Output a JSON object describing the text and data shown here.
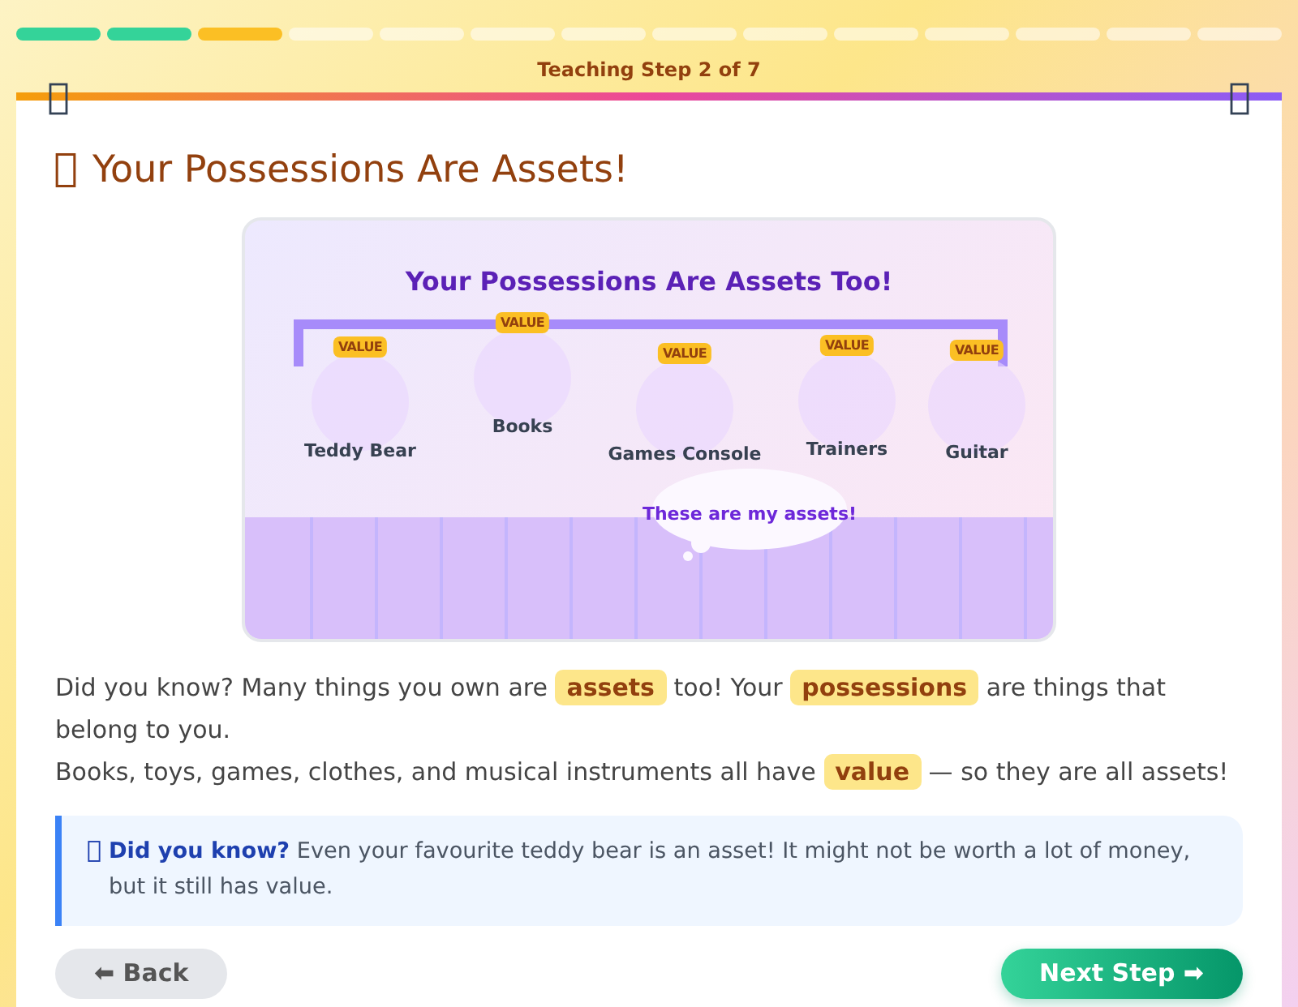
{
  "progress": {
    "segments": [
      {
        "kind": "done"
      },
      {
        "kind": "done"
      },
      {
        "kind": "current"
      },
      {
        "kind": "todo"
      },
      {
        "kind": "todo"
      },
      {
        "kind": "todo"
      },
      {
        "kind": "todo"
      },
      {
        "kind": "todo"
      },
      {
        "kind": "todo"
      },
      {
        "kind": "todo"
      },
      {
        "kind": "todo"
      },
      {
        "kind": "todo"
      },
      {
        "kind": "todo"
      },
      {
        "kind": "todo"
      }
    ],
    "label": "Teaching Step 2 of 7"
  },
  "card": {
    "title": "Your Possessions Are Assets!",
    "scene": {
      "title": "Your Possessions Are Assets Too!",
      "items": [
        {
          "name": "Teddy Bear",
          "badge": "VALUE"
        },
        {
          "name": "Books",
          "badge": "VALUE"
        },
        {
          "name": "Games Console",
          "badge": "VALUE"
        },
        {
          "name": "Trainers",
          "badge": "VALUE"
        },
        {
          "name": "Guitar",
          "badge": "VALUE"
        }
      ],
      "bubble": "These are my assets!"
    },
    "paragraphs": [
      "Did you know? Many things you own are **assets** too! Your **possessions** are things that belong to you.",
      "Books, toys, games, clothes, and musical instruments all have **value** — so they are all assets!"
    ],
    "callout": "**Did you know?** Even your favourite teddy bear is an asset! It might not be worth a lot of money, but it still has value.",
    "back_button": "⬅ Back",
    "next_button": "Next Step ➡"
  }
}
